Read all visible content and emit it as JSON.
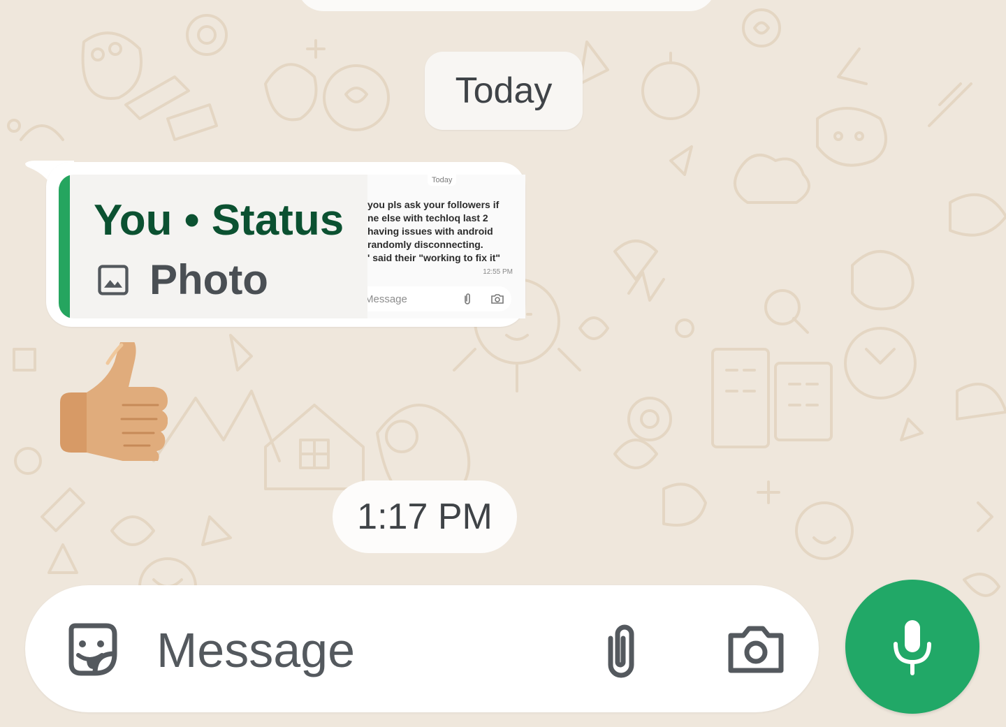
{
  "chat": {
    "date_separator": "Today",
    "time_separator": "1:17 PM",
    "reply": {
      "author": "You",
      "separator": "•",
      "source": "Status",
      "type_label": "Photo",
      "type_icon": "image-icon",
      "accent_color": "#25a55f",
      "thumbnail": {
        "date": "Today",
        "lines": [
          "you pls ask your followers if",
          "ne else with techloq last 2",
          " having issues with android",
          "randomly disconnecting.",
          "' said their \"working to fix it\""
        ],
        "time": "12:55 PM",
        "input_placeholder": "Message"
      }
    },
    "reaction_emoji": "thumbs-up-emoji"
  },
  "composer": {
    "placeholder": "Message",
    "sticker_icon": "sticker-icon",
    "attach_icon": "paperclip-icon",
    "camera_icon": "camera-icon",
    "mic_icon": "microphone-icon",
    "mic_button_color": "#21a867"
  }
}
